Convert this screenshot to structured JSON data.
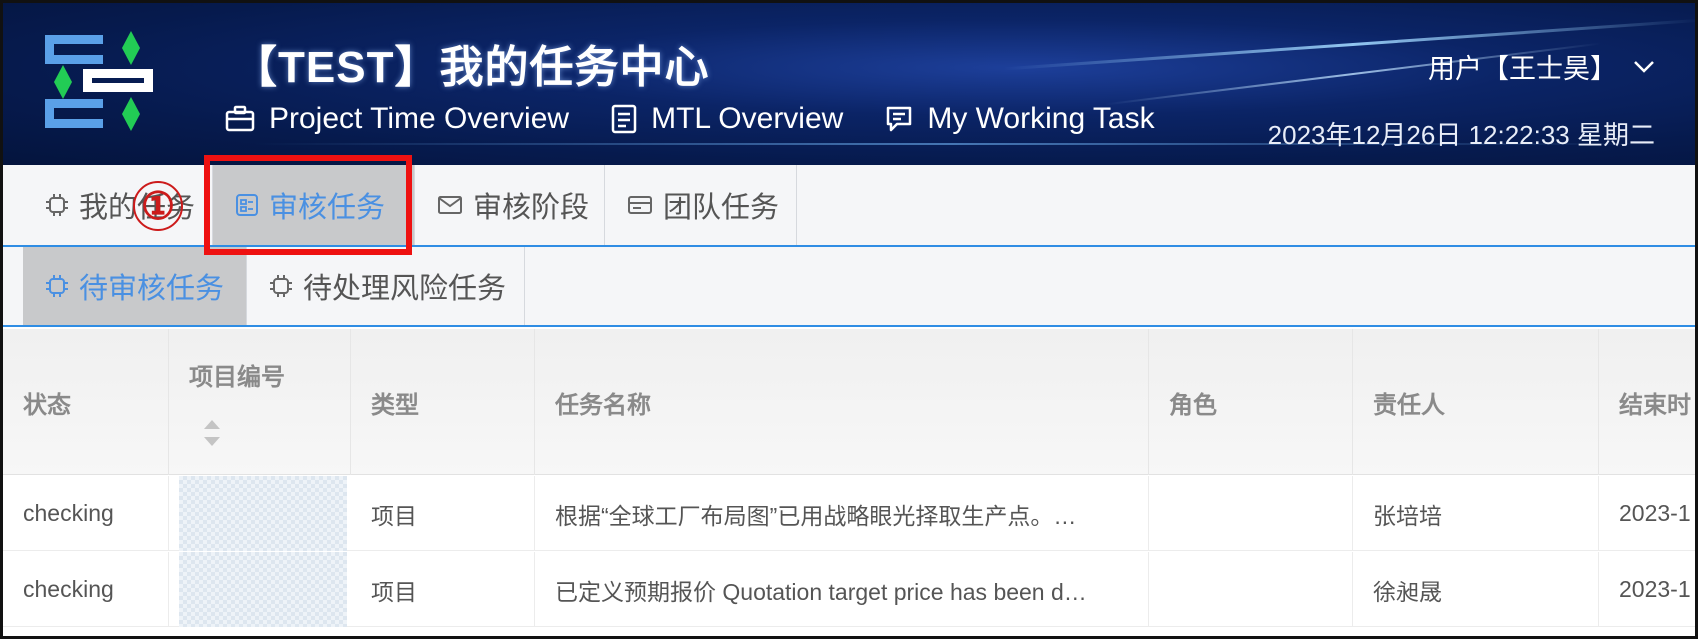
{
  "header": {
    "title": "【TEST】我的任务中心",
    "nav": [
      {
        "label": "Project Time Overview",
        "icon": "briefcase-icon"
      },
      {
        "label": "MTL Overview",
        "icon": "document-icon"
      },
      {
        "label": "My Working Task",
        "icon": "chat-icon"
      }
    ],
    "user": "用户【王士昊】",
    "datetime": "2023年12月26日  12:22:33  星期二"
  },
  "tabs_primary": [
    {
      "label": "我的任务",
      "icon": "chip-icon",
      "active": false
    },
    {
      "label": "审核任务",
      "icon": "audit-icon",
      "active": true
    },
    {
      "label": "审核阶段",
      "icon": "mail-icon",
      "active": false
    },
    {
      "label": "团队任务",
      "icon": "card-icon",
      "active": false
    }
  ],
  "tabs_secondary": [
    {
      "label": "待审核任务",
      "icon": "chip-icon",
      "active": true
    },
    {
      "label": "待处理风险任务",
      "icon": "chip-icon",
      "active": false
    }
  ],
  "annotation": {
    "marker": "①",
    "color": "#ee1111"
  },
  "table": {
    "columns": [
      "状态",
      "项目编号",
      "类型",
      "任务名称",
      "角色",
      "责任人",
      "结束时"
    ],
    "rows": [
      {
        "status": "checking",
        "project_no": "",
        "type": "项目",
        "task_name": "根据“全球工厂布局图”已用战略眼光择取生产点。…",
        "role": "",
        "owner": "张培培",
        "end": "2023-1"
      },
      {
        "status": "checking",
        "project_no": "",
        "type": "项目",
        "task_name": "已定义预期报价 Quotation target price has been d…",
        "role": "",
        "owner": "徐昶晟",
        "end": "2023-1"
      }
    ]
  },
  "colors": {
    "accent": "#4a90e2",
    "header_bg": "#061a4d",
    "active_tab_bg": "#c8c9cb",
    "annotation_red": "#ee1111"
  }
}
